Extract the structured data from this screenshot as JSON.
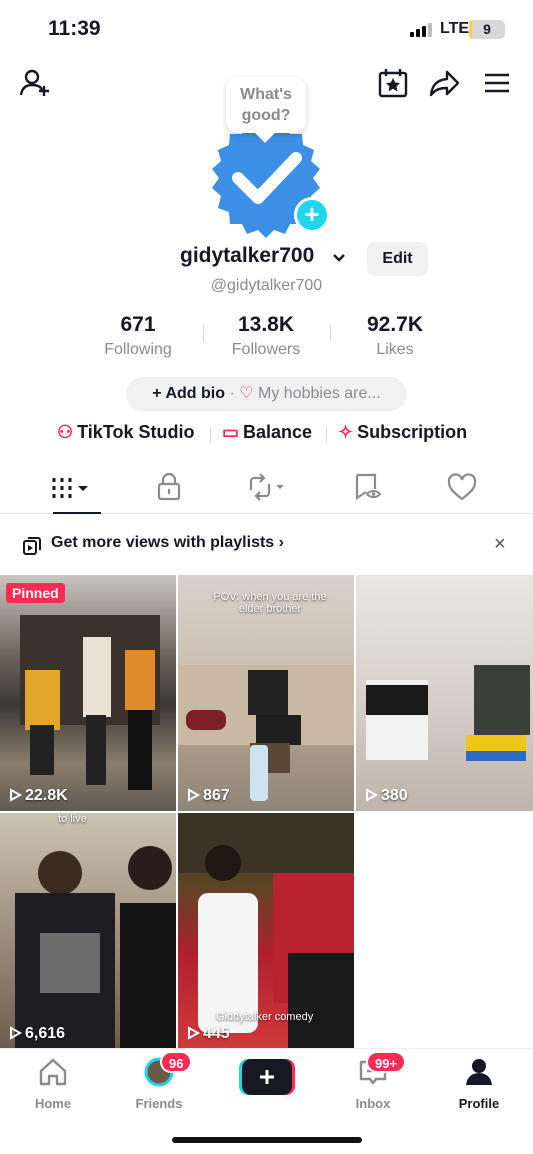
{
  "status_bar": {
    "time": "11:39",
    "network": "LTE",
    "battery": "9",
    "battery_fraction": 0.09
  },
  "top_bar": {
    "icons": [
      "add-friend-icon",
      "calendar-star-icon",
      "share-icon",
      "menu-icon"
    ]
  },
  "profile": {
    "bubble_text": "What's good?",
    "username": "gidytalker700",
    "handle": "@gidytalker700",
    "edit_label": "Edit",
    "stats": [
      {
        "value": "671",
        "label": "Following"
      },
      {
        "value": "13.8K",
        "label": "Followers"
      },
      {
        "value": "92.7K",
        "label": "Likes"
      }
    ],
    "add_bio": "Add bio",
    "bio_placeholder": "My hobbies are...",
    "links": [
      {
        "label": "TikTok Studio",
        "icon": "studio-icon"
      },
      {
        "label": "Balance",
        "icon": "wallet-icon"
      },
      {
        "label": "Subscription",
        "icon": "subscription-icon"
      }
    ]
  },
  "tabs": [
    "videos",
    "private",
    "reposts",
    "favorites",
    "liked"
  ],
  "banner": {
    "text": "Get more views with playlists",
    "chevron": "›",
    "close": "×"
  },
  "videos": [
    {
      "views": "22.8K",
      "pinned_label": "Pinned",
      "caption": ""
    },
    {
      "views": "867",
      "pinned_label": "",
      "caption": "POV: when you are the elder brother"
    },
    {
      "views": "380",
      "pinned_label": "",
      "caption": ""
    },
    {
      "views": "6,616",
      "pinned_label": "",
      "caption": "to live"
    },
    {
      "views": "445",
      "pinned_label": "",
      "caption": "Giddytalker comedy"
    }
  ],
  "nav": [
    {
      "label": "Home",
      "badge": ""
    },
    {
      "label": "Friends",
      "badge": "96"
    },
    {
      "label": "",
      "badge": ""
    },
    {
      "label": "Inbox",
      "badge": "99+"
    },
    {
      "label": "Profile",
      "badge": ""
    }
  ],
  "colors": {
    "accent": "#fe2c55",
    "cyan": "#20d5ec",
    "avatar": "#3d8fe6",
    "text": "#161823",
    "muted": "#8a8b91"
  }
}
